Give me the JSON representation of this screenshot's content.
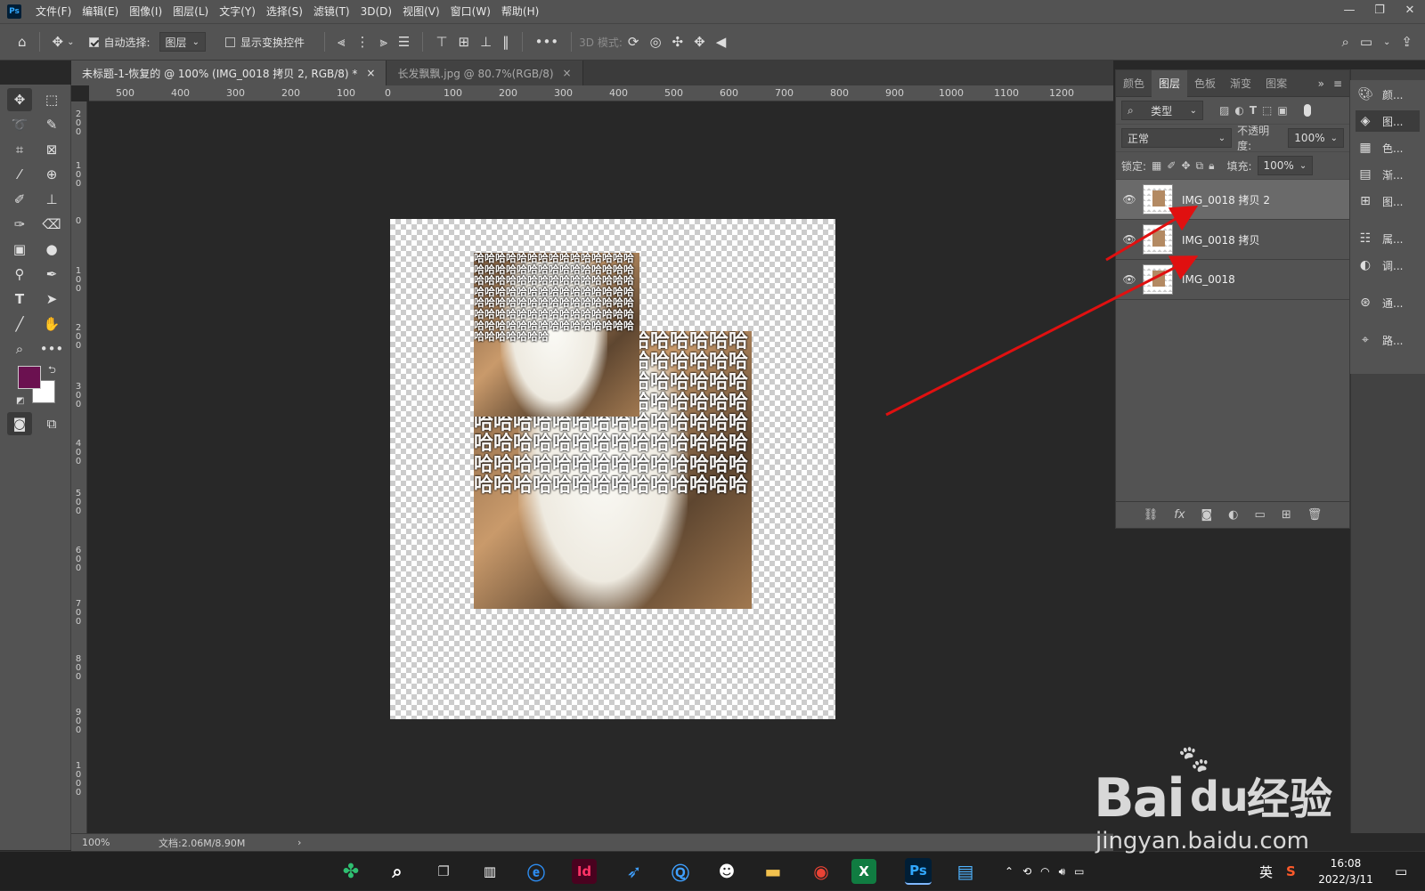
{
  "app": {
    "logo": "Ps"
  },
  "menu": [
    "文件(F)",
    "编辑(E)",
    "图像(I)",
    "图层(L)",
    "文字(Y)",
    "选择(S)",
    "滤镜(T)",
    "3D(D)",
    "视图(V)",
    "窗口(W)",
    "帮助(H)"
  ],
  "options": {
    "auto_select_label": "自动选择:",
    "auto_select_value": "图层",
    "show_transform_label": "显示变换控件",
    "mode_3d_label": "3D 模式:"
  },
  "tabs": [
    {
      "label": "未标题-1-恢复的 @ 100% (IMG_0018 拷贝 2, RGB/8) *",
      "close": "×"
    },
    {
      "label": "长发飘飘.jpg @ 80.7%(RGB/8)",
      "close": "×"
    }
  ],
  "ruler": {
    "h": [
      "500",
      "400",
      "300",
      "200",
      "100",
      "0",
      "100",
      "200",
      "300",
      "400",
      "500",
      "600",
      "700",
      "800",
      "900",
      "1000",
      "1100",
      "1200"
    ],
    "v": [
      "200",
      "100",
      "0",
      "100",
      "200",
      "300",
      "400",
      "500",
      "600",
      "700",
      "800",
      "900",
      "1000"
    ]
  },
  "canvas_text": {
    "ha_pattern": "哈哈哈哈哈哈哈哈哈哈哈哈哈哈哈哈哈哈哈哈哈哈哈哈哈哈哈哈哈哈哈哈哈哈哈哈哈哈哈哈哈哈哈哈哈哈哈哈哈哈哈哈哈哈哈哈哈哈哈哈哈哈哈哈哈哈哈哈哈哈哈哈哈哈哈哈哈哈哈哈哈哈哈哈哈哈哈哈哈哈哈哈哈哈哈哈哈哈哈哈哈哈哈哈哈哈哈哈哈哈哈哈"
  },
  "status": {
    "zoom": "100%",
    "doc": "文档:2.06M/8.90M",
    "arrow": "›"
  },
  "panel": {
    "tabs": [
      "颜色",
      "图层",
      "色板",
      "渐变",
      "图案"
    ],
    "active_tab": 1,
    "filter_label": "类型",
    "blend_mode": "正常",
    "opacity_label": "不透明度:",
    "opacity_value": "100%",
    "lock_label": "锁定:",
    "fill_label": "填充:",
    "fill_value": "100%",
    "layers": [
      {
        "name": "IMG_0018 拷贝 2",
        "selected": true
      },
      {
        "name": "IMG_0018 拷贝",
        "selected": false
      },
      {
        "name": "IMG_0018",
        "selected": false
      }
    ]
  },
  "dock": [
    "颜...",
    "图...",
    "色...",
    "渐...",
    "图...",
    "属...",
    "调...",
    "通...",
    "路..."
  ],
  "taskbar": {
    "ime": "英",
    "time": "16:08",
    "date": "2022/3/11"
  },
  "watermark": {
    "brand": "Bai",
    "brand2": "du",
    "cn": "经验",
    "url": "jingyan.baidu.com"
  },
  "colors": {
    "foreground": "#6b1150",
    "background": "#ffffff",
    "arrow": "#e01010"
  }
}
